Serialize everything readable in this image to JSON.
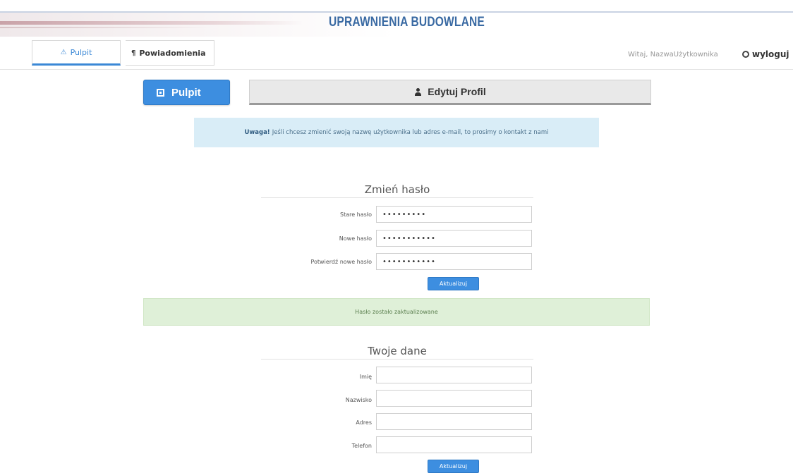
{
  "header": {
    "title": "UPRAWNIENIA BUDOWLANE"
  },
  "nav": {
    "tab_pulpit": "Pulpit",
    "tab_notifications": "Powiadomienia",
    "welcome": "Witaj, NazwaUżytkownika",
    "logout": "wyloguj"
  },
  "buttons": {
    "pulpit": "Pulpit",
    "edit_profile": "Edytuj Profil"
  },
  "info_alert": {
    "bold": "Uwaga!",
    "text": "Jeśli chcesz zmienić swoją nazwę użytkownika lub adres e-mail, to prosimy o kontakt z nami"
  },
  "password_section": {
    "title": "Zmień hasło",
    "old_label": "Stare hasło",
    "old_value": "•••••••••",
    "new_label": "Nowe hasło",
    "new_value": "•••••••••••",
    "confirm_label": "Potwierdź nowe hasło",
    "confirm_value": "•••••••••••",
    "submit": "Aktualizuj"
  },
  "success_alert": "Hasło zostało zaktualizowane",
  "profile_section": {
    "title": "Twoje dane",
    "first_name_label": "Imię",
    "last_name_label": "Nazwisko",
    "address_label": "Adres",
    "phone_label": "Telefon",
    "submit": "Aktualizuj"
  }
}
